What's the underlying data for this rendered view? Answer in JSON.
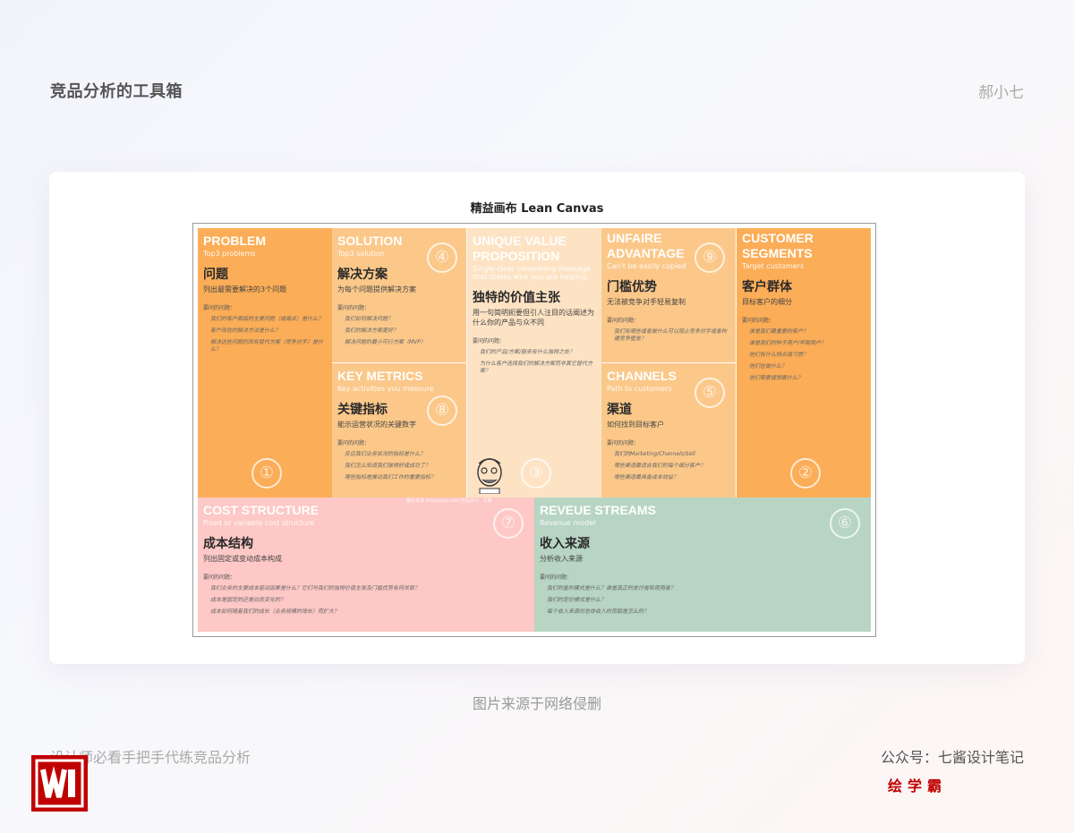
{
  "header": {
    "title": "竞品分析的工具箱",
    "author": "郝小七"
  },
  "canvas": {
    "title": "精益画布  Lean Canvas",
    "problem": {
      "en": "PROBLEM",
      "sub": "Top3 problems",
      "cn": "问题",
      "desc": "列出最需要解决的3个问题",
      "qh": "要问的问题：",
      "q": [
        "我们的客户面临的主要问题（或痛点）是什么？",
        "客户现在的解决方法是什么？",
        "解决这些问题的现有替代方案（竞争对手）是什么？"
      ],
      "num": "①"
    },
    "solution": {
      "en": "SOLUTION",
      "sub": "Top3 solution",
      "cn": "解决方案",
      "desc": "为每个问题提供解决方案",
      "qh": "要问的问题：",
      "q": [
        "我们如何解决问题？",
        "我们的解决方案更好？",
        "解决问题的最小可行方案（MVP）"
      ],
      "num": "④"
    },
    "uvp": {
      "en": "UNIQUE VALUE PROPOSITION",
      "sub": "Single clear compelling message that states who you are helping",
      "cn": "独特的价值主张",
      "desc": "用一句简明扼要但引人注目的话阐述为什么你的产品与众不同",
      "qh": "要问的问题：",
      "q": [
        "我们的产品/方案/服务有什么独特之处？",
        "为什么客户选择我们的解决方案而非其它替代方案？"
      ],
      "num": "③",
      "watermark": "图片来源 Processon.com 作品设计：文静"
    },
    "unfair": {
      "en": "UNFAIRE ADVANTAGE",
      "sub": "Can't be easily copied",
      "cn": "门槛优势",
      "desc": "无法被竞争对手轻易复制",
      "qh": "要问的问题：",
      "q": [
        "我们有哪些或者做什么可以阻止竞争对手或者构建竞争壁垒？"
      ],
      "num": "⑨"
    },
    "segments": {
      "en": "CUSTOMER SEGMENTS",
      "sub": "Target customers",
      "cn": "客户群体",
      "desc": "目标客户的细分",
      "qh": "要问的问题：",
      "q": [
        "谁是我们最重要的客户？",
        "谁是我们的种子用户/早期用户？",
        "他们有什么特点或习惯？",
        "他们在做什么？",
        "他们需要或想要什么？"
      ],
      "num": "②"
    },
    "metrics": {
      "en": "KEY METRICS",
      "sub": "Key activities you measure",
      "cn": "关键指标",
      "desc": "能示运营状况的关键数字",
      "qh": "要问的问题：",
      "q": [
        "反应我们业务状况的指标是什么？",
        "我们怎么知道我们做得好或成功了？",
        "哪些指标是推动我们工作的重要指标？"
      ],
      "num": "⑧"
    },
    "channels": {
      "en": "CHANNELS",
      "sub": "Path to customers",
      "cn": "渠道",
      "desc": "如何找到目标客户",
      "qh": "要问的问题：",
      "q": [
        "我们的Marketing/Channels/Sell",
        "哪些渠道最适合我们的每个细分客户？",
        "哪些渠道最具备成本效益？"
      ],
      "num": "⑤"
    },
    "cost": {
      "en": "COST STRUCTURE",
      "sub": "Fixed or variable cost structure",
      "cn": "成本结构",
      "desc": "列出固定或变动成本构成",
      "qh": "要问的问题：",
      "q": [
        "我们业务的主要成本驱动因素是什么？它们与我们的独特价值主张及门槛优势有何关联？",
        "成本是固定的还是动态变化的？",
        "成本如何随着我们的成长（业务规模的增长）而扩大？"
      ],
      "num": "⑦"
    },
    "revenue": {
      "en": "REVEUE STREAMS",
      "sub": "Revenue model",
      "cn": "收入来源",
      "desc": "分析收入来源",
      "qh": "要问的问题：",
      "q": [
        "我们的盈利模式是什么？谁是真正的支付者和使用者？",
        "我们的定价模式是什么？",
        "每个收入来源对总体收入的贡献是怎么的？"
      ],
      "num": "⑥"
    }
  },
  "caption": "图片来源于网络侵删",
  "footer": {
    "left": "设计师必看手把手代练竞品分析",
    "right": "公众号：七酱设计笔记",
    "brand": "绘学霸"
  },
  "colors": {
    "orange": "#fbad57",
    "light_orange": "#fbc88a",
    "cream": "#fde3c4",
    "pink": "#fdc8c6",
    "green": "#b7d5c2",
    "brand_red": "#c00000"
  }
}
